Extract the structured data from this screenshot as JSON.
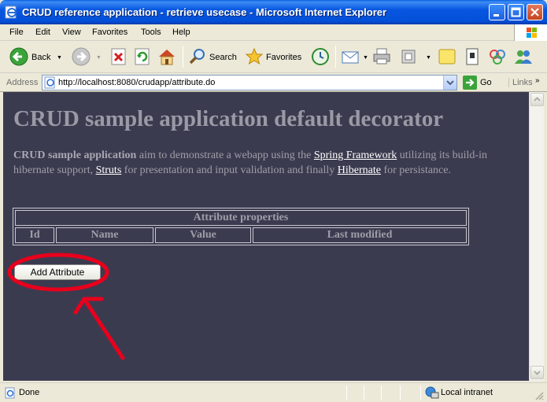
{
  "window": {
    "title": "CRUD reference application - retrieve usecase - Microsoft Internet Explorer"
  },
  "menu": [
    "File",
    "Edit",
    "View",
    "Favorites",
    "Tools",
    "Help"
  ],
  "toolbar": {
    "back": "Back",
    "search": "Search",
    "favorites": "Favorites"
  },
  "address": {
    "label": "Address",
    "url": "http://localhost:8080/crudapp/attribute.do",
    "go": "Go",
    "links": "Links"
  },
  "page": {
    "heading": "CRUD sample application default decorator",
    "intro": {
      "bold": "CRUD sample application",
      "t1": " aim to demonstrate a webapp using the ",
      "link1": "Spring Framework",
      "t2": " utilizing its build-in hibernate support, ",
      "link2": "Struts",
      "t3": " for presentation and input validation and finally ",
      "link3": "Hibernate",
      "t4": " for persistance."
    },
    "table": {
      "caption": "Attribute properties",
      "columns": [
        "Id",
        "Name",
        "Value",
        "Last modified"
      ]
    },
    "add_button": "Add Attribute"
  },
  "status": {
    "text": "Done",
    "zone": "Local intranet"
  },
  "colors": {
    "content_bg": "#3b3b50",
    "annotation": "#e8001c"
  }
}
